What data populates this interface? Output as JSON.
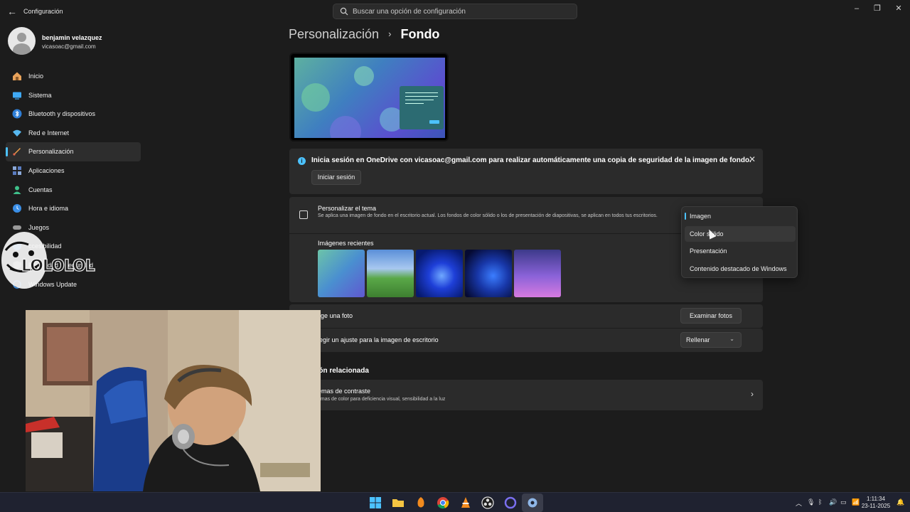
{
  "window": {
    "title": "Configuración",
    "search_placeholder": "Buscar una opción de configuración"
  },
  "user": {
    "name": "benjamin velazquez",
    "email": "vicasoac@gmail.com"
  },
  "sidebar": {
    "items": [
      {
        "label": "Inicio",
        "icon": "home-icon"
      },
      {
        "label": "Sistema",
        "icon": "system-icon"
      },
      {
        "label": "Bluetooth y dispositivos",
        "icon": "bluetooth-icon"
      },
      {
        "label": "Red e Internet",
        "icon": "wifi-icon"
      },
      {
        "label": "Personalización",
        "icon": "brush-icon",
        "active": true
      },
      {
        "label": "Aplicaciones",
        "icon": "apps-icon"
      },
      {
        "label": "Cuentas",
        "icon": "account-icon"
      },
      {
        "label": "Hora e idioma",
        "icon": "globe-clock-icon"
      },
      {
        "label": "Juegos",
        "icon": "gamepad-icon"
      },
      {
        "label": "ccesibilidad",
        "icon": "accessibility-icon"
      },
      {
        "label": "Privacidad y seguridad",
        "icon": "shield-icon"
      },
      {
        "label": "Windows Update",
        "icon": "update-icon"
      }
    ]
  },
  "breadcrumb": {
    "parent": "Personalización",
    "separator": "›",
    "current": "Fondo"
  },
  "onedrive_banner": {
    "text": "Inicia sesión en OneDrive con vicasoac@gmail.com para realizar automáticamente una copia de seguridad de la imagen de fondo.",
    "button": "Iniciar sesión",
    "close": "✕"
  },
  "theme": {
    "title": "Personalizar el tema",
    "description": "Se aplica una imagen de fondo en el escritorio actual. Los fondos de color sólido o los de presentación de diapositivas, se aplican en todos tus escritorios.",
    "recent_label": "Imágenes recientes",
    "dropdown_options": [
      "Imagen",
      "Color sólido",
      "Presentación",
      "Contenido destacado de Windows"
    ],
    "selected_option": "Imagen",
    "hovered_option": "Color sólido"
  },
  "choose_photo": {
    "label": "lige una foto",
    "button": "Examinar fotos"
  },
  "fit": {
    "label": "legir un ajuste para la imagen de escritorio",
    "value": "Rellenar",
    "chevron": "⌄"
  },
  "related": {
    "title": "ción relacionada",
    "item_title": "emas de contraste",
    "item_desc": "emas de color para deficiencia visual, sensibilidad a la luz",
    "chevron": "›"
  },
  "overlay": {
    "meme_text": "LOLOLOL"
  },
  "taskbar": {
    "time": "1:11:34",
    "date": "23-11-2025"
  },
  "colors": {
    "accent": "#4cc2ff",
    "background": "#1c1c1c",
    "card": "#2b2b2b"
  }
}
